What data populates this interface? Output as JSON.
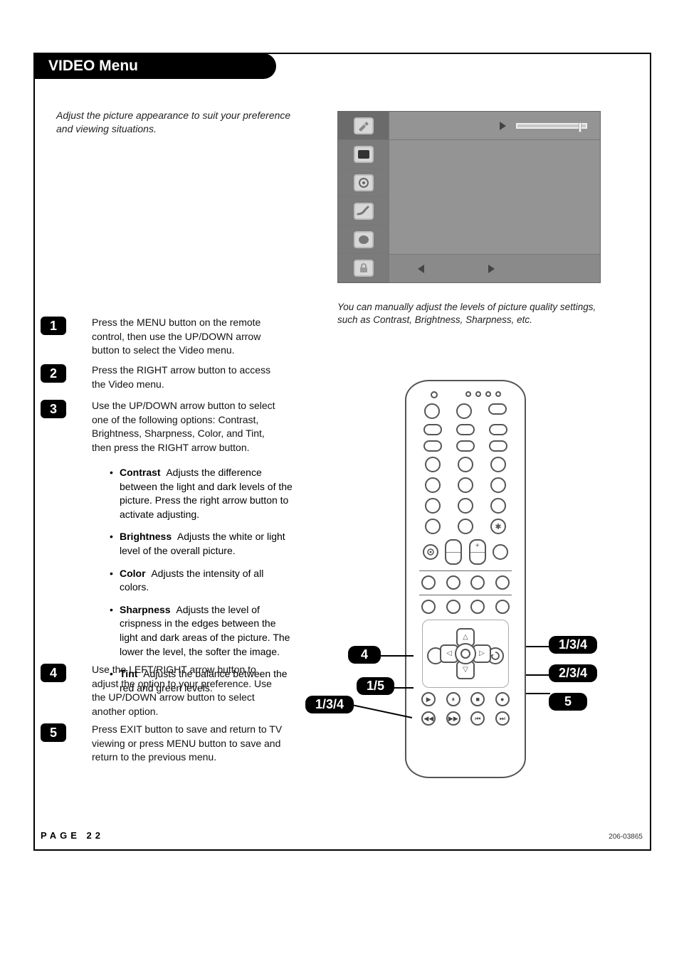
{
  "header": {
    "title": "VIDEO Menu"
  },
  "intro": "Adjust the picture appearance to suit your preference and viewing situations.",
  "caption": "You can manually adjust the levels of picture quality settings, such as Contrast, Brightness, Sharpness, etc.",
  "steps": [
    {
      "n": "1",
      "text": "Press the MENU button on the remote control, then use the UP/DOWN arrow button to select the Video menu."
    },
    {
      "n": "2",
      "text": "Press the RIGHT arrow button to access the Video menu."
    },
    {
      "n": "3",
      "text": "Use the UP/DOWN arrow button to select one of the following options: Contrast, Brightness, Sharpness, Color, and Tint, then press the RIGHT arrow button."
    },
    {
      "n": "4",
      "text": "Use the LEFT/RIGHT arrow button to adjust the option to your preference. Use the UP/DOWN arrow button to select another option."
    },
    {
      "n": "5",
      "text": "Press EXIT button to save and return to TV viewing or press MENU button to save and return to the previous menu."
    }
  ],
  "bullets": [
    {
      "label": "Contrast",
      "text": "Adjusts the difference between the light and dark levels of the picture. Press the right arrow button to activate adjusting."
    },
    {
      "label": "Brightness",
      "text": "Adjusts the white or light level of the overall picture."
    },
    {
      "label": "Color",
      "text": "Adjusts the intensity of all colors."
    },
    {
      "label": "Sharpness",
      "text": "Adjusts the level of crispness in the edges between the light and dark areas of the picture. The lower the level, the softer the image."
    },
    {
      "label": "Tint",
      "text": "Adjusts the balance between the red and green levels."
    }
  ],
  "callouts": {
    "top_right": "1/3/4",
    "mid_right": "2/3/4",
    "bot_right": "5",
    "left_upper": "4",
    "left_lower": "1/5",
    "far_left": "1/3/4"
  },
  "footer": {
    "page": "PAGE 22",
    "doc": "206-03865"
  }
}
